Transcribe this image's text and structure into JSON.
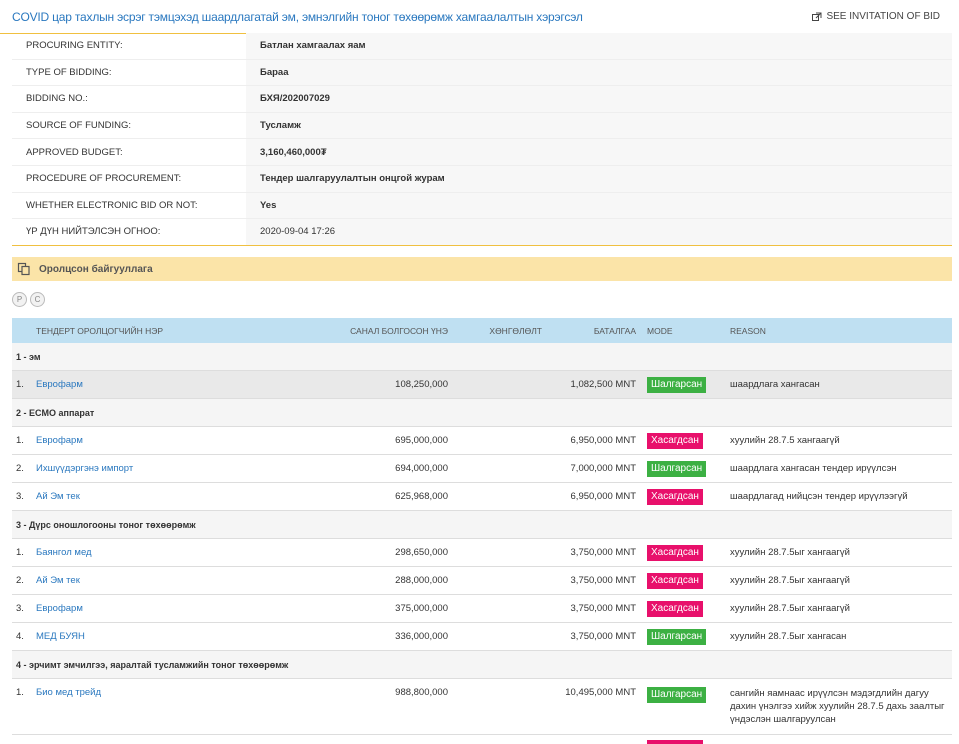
{
  "header": {
    "title": "COVID цар тахлын эсрэг тэмцэхэд шаардлагатай эм, эмнэлгийн тоног төхөөрөмж хамгаалалтын хэрэгсэл",
    "invite_label": "SEE INVITATION OF BID"
  },
  "info": [
    {
      "label": "PROCURING ENTITY:",
      "value": "Батлан хамгаалах яам"
    },
    {
      "label": "TYPE OF BIDDING:",
      "value": "Бараа"
    },
    {
      "label": "BIDDING NO.:",
      "value": "БХЯ/202007029"
    },
    {
      "label": "SOURCE OF FUNDING:",
      "value": "Тусламж"
    },
    {
      "label": "APPROVED BUDGET:",
      "value": "3,160,460,000₮"
    },
    {
      "label": "PROCEDURE OF PROCUREMENT:",
      "value": "Тендер шалгаруулалтын онцгой журам"
    },
    {
      "label": "WHETHER ELECTRONIC BID OR NOT:",
      "value": "Yes"
    },
    {
      "label": "ҮР ДҮН НИЙТЭЛСЭН ОГНОО:",
      "value": "2020-09-04 17:26"
    }
  ],
  "section": {
    "title": "Оролцсон байгууллага"
  },
  "tools": {
    "p": "P",
    "c": "C"
  },
  "table": {
    "headers": {
      "name": "ТЕНДЕРТ ОРОЛЦОГЧИЙН НЭР",
      "price": "САНАЛ БОЛГОСОН ҮНЭ",
      "discount": "ХӨНГӨЛӨЛТ",
      "guarantee": "БАТАЛГАА",
      "mode": "MODE",
      "reason": "REASON"
    },
    "groups": [
      {
        "title": "1 - эм",
        "rows": [
          {
            "no": "1.",
            "name": "Еврофарм",
            "price": "108,250,000",
            "discount": "",
            "guarantee": "1,082,500 MNT",
            "mode": "Шалгарсан",
            "reason": "шаардлага хангасан"
          }
        ]
      },
      {
        "title": "2 - ECMO аппарат",
        "rows": [
          {
            "no": "1.",
            "name": "Еврофарм",
            "price": "695,000,000",
            "discount": "",
            "guarantee": "6,950,000 MNT",
            "mode": "Хасагдсан",
            "reason": "хуулийн 28.7.5 хангаагүй"
          },
          {
            "no": "2.",
            "name": "Ихшүүдэргэнэ импорт",
            "price": "694,000,000",
            "discount": "",
            "guarantee": "7,000,000 MNT",
            "mode": "Шалгарсан",
            "reason": "шаардлага хангасан тендер ирүүлсэн"
          },
          {
            "no": "3.",
            "name": "Ай Эм тек",
            "price": "625,968,000",
            "discount": "",
            "guarantee": "6,950,000 MNT",
            "mode": "Хасагдсан",
            "reason": "шаардлагад нийцсэн тендер ирүүлээгүй"
          }
        ]
      },
      {
        "title": "3 - Дүрс оношлогооны тоног төхөөрөмж",
        "rows": [
          {
            "no": "1.",
            "name": "Баянгол мед",
            "price": "298,650,000",
            "discount": "",
            "guarantee": "3,750,000 MNT",
            "mode": "Хасагдсан",
            "reason": "хуулийн 28.7.5ыг хангаагүй"
          },
          {
            "no": "2.",
            "name": "Ай Эм тек",
            "price": "288,000,000",
            "discount": "",
            "guarantee": "3,750,000 MNT",
            "mode": "Хасагдсан",
            "reason": "хуулийн 28.7.5ыг хангаагүй"
          },
          {
            "no": "3.",
            "name": "Еврофарм",
            "price": "375,000,000",
            "discount": "",
            "guarantee": "3,750,000 MNT",
            "mode": "Хасагдсан",
            "reason": "хуулийн 28.7.5ыг хангаагүй"
          },
          {
            "no": "4.",
            "name": "МЕД БУЯН",
            "price": "336,000,000",
            "discount": "",
            "guarantee": "3,750,000 MNT",
            "mode": "Шалгарсан",
            "reason": "хуулийн 28.7.5ыг хангасан"
          }
        ]
      },
      {
        "title": "4 - эрчимт эмчилгээ, яаралтай тусламжийн тоног төхөөрөмж",
        "rows": [
          {
            "no": "1.",
            "name": "Био мед трейд",
            "price": "988,800,000",
            "discount": "",
            "guarantee": "10,495,000 MNT",
            "mode": "Шалгарсан",
            "reason": "сангийн яамнаас ирүүлсэн мэдэгдлийн дагуу дахин үнэлгээ хийж хуулийн 28.7.5 дахь заалтыг үндэслэн шалгаруулсан"
          }
        ]
      }
    ]
  },
  "colors": {
    "accepted": "#3cb043",
    "rejected": "#e8106b",
    "link": "#2a78bf",
    "section": "#fbe4a8",
    "table_head": "#bfe0f2"
  }
}
